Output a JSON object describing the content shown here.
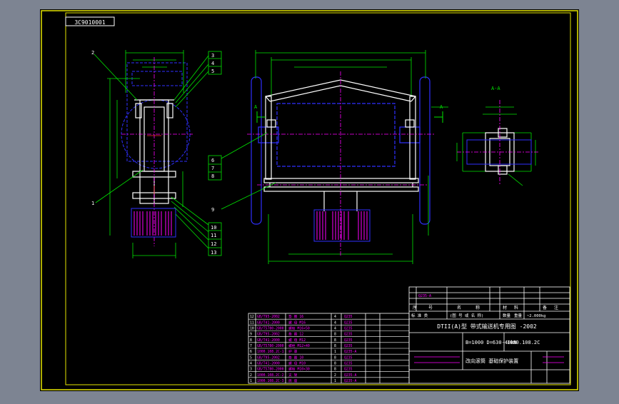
{
  "drawing_number": "3C9010001",
  "section_label": "A-A",
  "section_marks": [
    "A",
    "A"
  ],
  "balloons": {
    "left": [
      "2",
      "3",
      "4",
      "5",
      "1",
      "10",
      "11",
      "12",
      "13"
    ],
    "middle": [
      "6",
      "7",
      "8",
      "9"
    ]
  },
  "title_block": {
    "top_rows": [
      "Q235-A",
      "",
      "",
      "",
      "",
      ""
    ],
    "header_cells": [
      "序",
      "号",
      "名",
      "称",
      "材",
      "料",
      "备",
      "注"
    ],
    "standard_row": [
      "标 准 类",
      "(图 号 或 名 称)",
      "数量",
      "重量",
      "~2.000kg"
    ],
    "series_title": "DTII(A)型  带式输送机专用图 -2002",
    "spec_text": "B=1000 D=630-40kN",
    "drawing_code": "1000.108.2C",
    "part_title": "改向滚筒 基础保护装置"
  },
  "bom_rows": [
    [
      "12",
      "GB/T95-2002",
      "垫 圈 16",
      "4",
      "Q235"
    ],
    [
      "11",
      "GB/T41-2000",
      "螺 母 M16",
      "4",
      "Q235"
    ],
    [
      "10",
      "GB/T5780-2000",
      "螺栓 M16×50",
      "4",
      "Q235"
    ],
    [
      "9",
      "GB/T95-2002",
      "垫 圈 12",
      "8",
      "Q235"
    ],
    [
      "8",
      "GB/T41-2000",
      "螺 母 M12",
      "8",
      "Q235"
    ],
    [
      "7",
      "GB/T5780-2000",
      "螺栓 M12×40",
      "8",
      "Q235"
    ],
    [
      "6",
      "1000.108.2C-1",
      "护 罩",
      "1",
      "Q235-A"
    ],
    [
      "5",
      "GB/T95-2002",
      "垫 圈 10",
      "8",
      "Q235"
    ],
    [
      "4",
      "GB/T41-2000",
      "螺 母 M10",
      "8",
      "Q235"
    ],
    [
      "3",
      "GB/T5780-2000",
      "螺栓 M10×30",
      "8",
      "Q235"
    ],
    [
      "2",
      "1000.108.2C-2",
      "支 架",
      "2",
      "Q235-A"
    ],
    [
      "1",
      "1000.108.2C-3",
      "底 座",
      "1",
      "Q235-A"
    ]
  ],
  "colors": {
    "background": "#000000",
    "frame": "#e6e600",
    "white": "#ffffff",
    "green": "#00e600",
    "blue": "#2f2fff",
    "magenta": "#ff00ff",
    "red": "#ff3030"
  }
}
